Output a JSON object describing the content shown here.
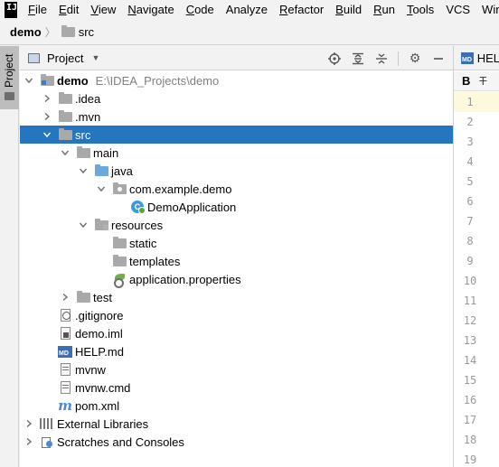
{
  "menu": {
    "logo": "IJ",
    "items": [
      {
        "mnemonic": "F",
        "rest": "ile"
      },
      {
        "mnemonic": "E",
        "rest": "dit"
      },
      {
        "mnemonic": "V",
        "rest": "iew"
      },
      {
        "mnemonic": "N",
        "rest": "avigate"
      },
      {
        "mnemonic": "C",
        "rest": "ode"
      },
      {
        "mnemonic": "",
        "rest": "Analyze"
      },
      {
        "mnemonic": "R",
        "rest": "efactor"
      },
      {
        "mnemonic": "B",
        "rest": "uild"
      },
      {
        "mnemonic": "R",
        "rest": "un"
      },
      {
        "mnemonic": "T",
        "rest": "ools"
      },
      {
        "mnemonic": "",
        "rest": "VCS"
      },
      {
        "mnemonic": "",
        "rest": "Wind"
      }
    ]
  },
  "breadcrumb": {
    "root": "demo",
    "separator": "〉",
    "current": "src"
  },
  "stripe": {
    "label": "Project"
  },
  "panel": {
    "title": "Project"
  },
  "tree": [
    {
      "label": "demo",
      "path": "E:\\IDEA_Projects\\demo",
      "arrow": "down",
      "icon": "module-folder",
      "depth": 0
    },
    {
      "label": ".idea",
      "arrow": "right",
      "icon": "folder",
      "depth": 1
    },
    {
      "label": ".mvn",
      "arrow": "right",
      "icon": "folder",
      "depth": 1
    },
    {
      "label": "src",
      "arrow": "down",
      "icon": "folder",
      "depth": 1,
      "selected": true
    },
    {
      "label": "main",
      "arrow": "down",
      "icon": "folder",
      "depth": 2
    },
    {
      "label": "java",
      "arrow": "down",
      "icon": "source-folder",
      "depth": 3
    },
    {
      "label": "com.example.demo",
      "arrow": "down",
      "icon": "package",
      "depth": 4
    },
    {
      "label": "DemoApplication",
      "arrow": "",
      "icon": "spring-class",
      "depth": 5
    },
    {
      "label": "resources",
      "arrow": "down",
      "icon": "resources-folder",
      "depth": 3
    },
    {
      "label": "static",
      "arrow": "",
      "icon": "folder",
      "depth": 4
    },
    {
      "label": "templates",
      "arrow": "",
      "icon": "folder",
      "depth": 4
    },
    {
      "label": "application.properties",
      "arrow": "",
      "icon": "properties",
      "depth": 4
    },
    {
      "label": "test",
      "arrow": "right",
      "icon": "folder",
      "depth": 2
    },
    {
      "label": ".gitignore",
      "arrow": "",
      "icon": "gitignore",
      "depth": 1
    },
    {
      "label": "demo.iml",
      "arrow": "",
      "icon": "iml",
      "depth": 1
    },
    {
      "label": "HELP.md",
      "arrow": "",
      "icon": "md",
      "depth": 1
    },
    {
      "label": "mvnw",
      "arrow": "",
      "icon": "script",
      "depth": 1
    },
    {
      "label": "mvnw.cmd",
      "arrow": "",
      "icon": "script",
      "depth": 1
    },
    {
      "label": "pom.xml",
      "arrow": "",
      "icon": "maven",
      "depth": 1
    },
    {
      "label": "External Libraries",
      "arrow": "right",
      "icon": "libraries",
      "depth": 0
    },
    {
      "label": "Scratches and Consoles",
      "arrow": "right",
      "icon": "scratches",
      "depth": 0
    }
  ],
  "editor": {
    "tab_label": "HEL",
    "md_badge": "MD",
    "toolbar_bold": "B",
    "toolbar_strike": "Ŧ",
    "line_numbers": [
      "1",
      "2",
      "3",
      "4",
      "5",
      "6",
      "7",
      "8",
      "9",
      "10",
      "11",
      "12",
      "13",
      "14",
      "15",
      "16",
      "17",
      "18",
      "19"
    ]
  },
  "colors": {
    "selection": "#2675bf",
    "folder_blue": "#6fa8dc",
    "current_line": "#fdf9dd"
  }
}
